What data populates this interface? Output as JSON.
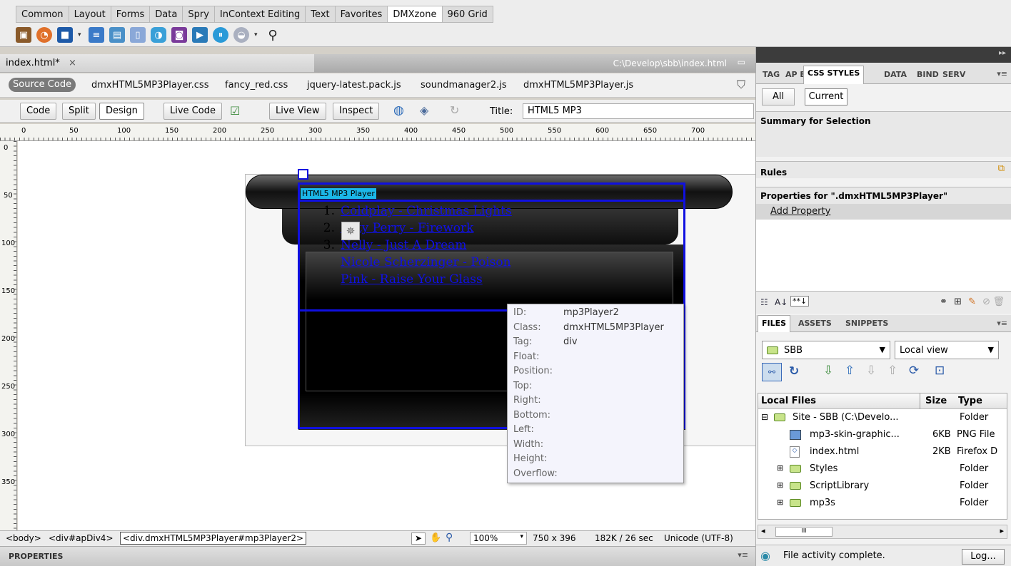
{
  "insert_tabs": [
    "Common",
    "Layout",
    "Forms",
    "Data",
    "Spry",
    "InContext Editing",
    "Text",
    "Favorites",
    "DMXzone",
    "960 Grid"
  ],
  "active_insert_tab": "DMXzone",
  "doc": {
    "tab_label": "index.html*",
    "close_glyph": "×",
    "path": "C:\\Develop\\sbb\\index.html",
    "related_files": [
      "dmxHTML5MP3Player.css",
      "fancy_red.css",
      "jquery-latest.pack.js",
      "soundmanager2.js",
      "dmxHTML5MP3Player.js"
    ],
    "source_code_label": "Source Code"
  },
  "viewbar": {
    "code": "Code",
    "split": "Split",
    "design": "Design",
    "live_code": "Live Code",
    "live_view": "Live View",
    "inspect": "Inspect",
    "title_label": "Title:",
    "title_value": "HTML5 MP3"
  },
  "ruler": {
    "h_ticks": [
      "0",
      "50",
      "100",
      "150",
      "200",
      "250",
      "300",
      "350",
      "400",
      "450",
      "500",
      "550",
      "600",
      "650",
      "700"
    ],
    "v_ticks": [
      "0",
      "50",
      "100",
      "150",
      "200",
      "250",
      "300",
      "350"
    ]
  },
  "player": {
    "label": "HTML5 MP3 Player",
    "tracks": [
      {
        "num": "1.",
        "title": "Coldplay - Christmas Lights"
      },
      {
        "num": "2.",
        "title": "Katy Perry - Firework"
      },
      {
        "num": "3.",
        "title": "Nelly - Just A Dream"
      },
      {
        "num": "",
        "title": "Nicole Scherzinger - Poison"
      },
      {
        "num": "",
        "title": "Pink - Raise Your Glass"
      }
    ]
  },
  "tooltip": {
    "rows": [
      {
        "k": "ID:",
        "v": "mp3Player2"
      },
      {
        "k": "Class:",
        "v": "dmxHTML5MP3Player"
      },
      {
        "k": "Tag:",
        "v": "div"
      },
      {
        "k": "Float:",
        "v": ""
      },
      {
        "k": "Position:",
        "v": ""
      },
      {
        "k": "Top:",
        "v": ""
      },
      {
        "k": "Right:",
        "v": ""
      },
      {
        "k": "Bottom:",
        "v": ""
      },
      {
        "k": "Left:",
        "v": ""
      },
      {
        "k": "Width:",
        "v": ""
      },
      {
        "k": "Height:",
        "v": ""
      },
      {
        "k": "Overflow:",
        "v": ""
      }
    ]
  },
  "status": {
    "tag_body": "<body>",
    "tag_div": "<div#apDiv4>",
    "tag_sel": "<div.dmxHTML5MP3Player#mp3Player2>",
    "zoom": "100%",
    "size": "750 x 396",
    "download": "182K / 26 sec",
    "encoding": "Unicode (UTF-8)"
  },
  "properties_label": "PROPERTIES",
  "css_panel": {
    "tabs": [
      "TAG",
      "AP E",
      "CSS STYLES",
      "DATA",
      "BIND",
      "SERV"
    ],
    "all_btn": "All",
    "current_btn": "Current",
    "summary": "Summary for Selection",
    "rules": "Rules",
    "properties_for": "Properties for \".dmxHTML5MP3Player\"",
    "add_property": "Add Property"
  },
  "files_panel": {
    "tabs": [
      "FILES",
      "ASSETS",
      "SNIPPETS"
    ],
    "site": "SBB",
    "view": "Local view",
    "col_local": "Local Files",
    "col_size": "Size",
    "col_type": "Type",
    "items": [
      {
        "name": "Site - SBB (C:\\Develo...",
        "size": "",
        "type": "Folder"
      },
      {
        "name": "mp3-skin-graphic...",
        "size": "6KB",
        "type": "PNG File"
      },
      {
        "name": "index.html",
        "size": "2KB",
        "type": "Firefox D"
      },
      {
        "name": "Styles",
        "size": "",
        "type": "Folder"
      },
      {
        "name": "ScriptLibrary",
        "size": "",
        "type": "Folder"
      },
      {
        "name": "mp3s",
        "size": "",
        "type": "Folder"
      }
    ],
    "activity": "File activity complete.",
    "log_btn": "Log..."
  }
}
